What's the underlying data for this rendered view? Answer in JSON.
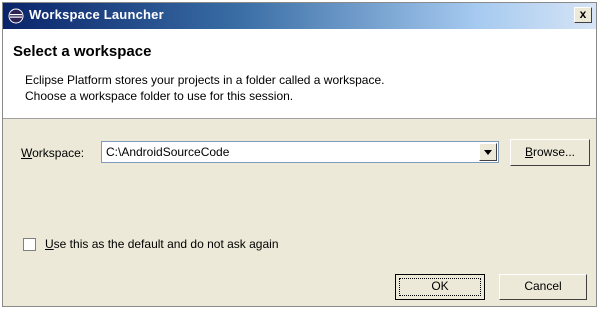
{
  "window": {
    "title": "Workspace Launcher",
    "close_glyph": "x"
  },
  "header": {
    "title": "Select a workspace",
    "desc_line1": "Eclipse Platform stores your projects in a folder called a workspace.",
    "desc_line2": "Choose a workspace folder to use for this session."
  },
  "workspace": {
    "label": "Workspace:",
    "value": "C:\\AndroidSourceCode",
    "browse_label": "Browse..."
  },
  "default_checkbox": {
    "label": "Use this as the default and do not ask again",
    "checked": false
  },
  "buttons": {
    "ok": "OK",
    "cancel": "Cancel"
  },
  "icons": {
    "title": "eclipse-icon",
    "dropdown": "chevron-down-icon"
  }
}
